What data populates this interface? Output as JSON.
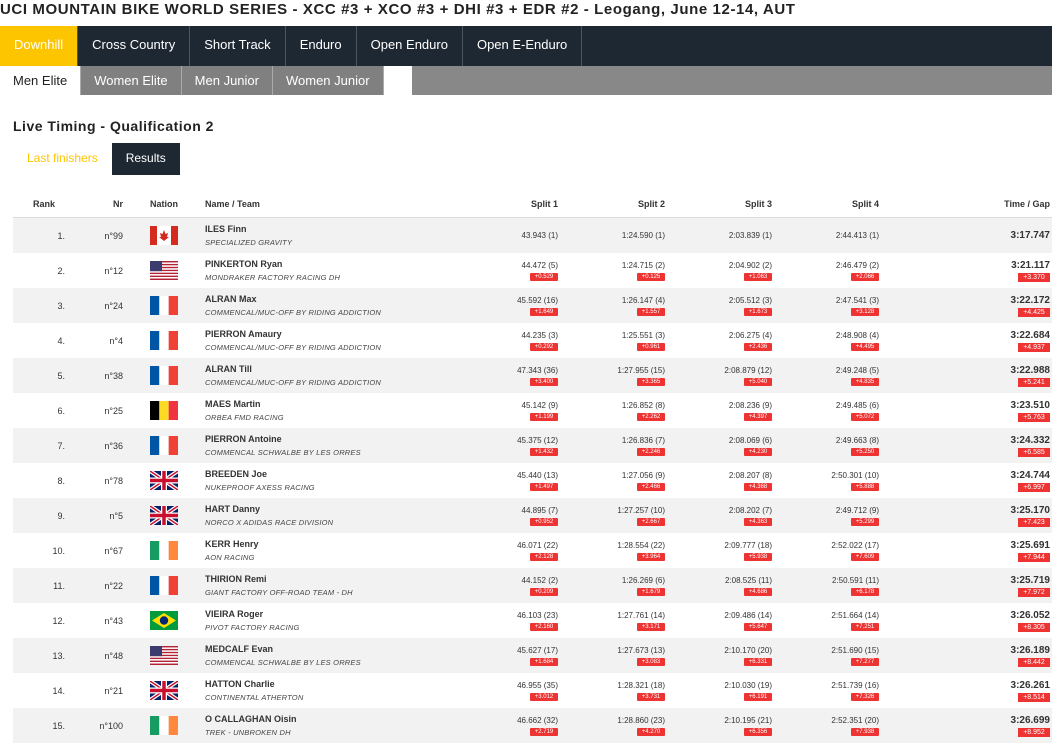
{
  "title": "UCI MOUNTAIN BIKE WORLD SERIES - XCC #3 + XCO #3 + DHI #3 + EDR #2 - Leogang, June 12-14, AUT",
  "disciplines": [
    {
      "label": "Downhill",
      "active": true
    },
    {
      "label": "Cross Country",
      "active": false
    },
    {
      "label": "Short Track",
      "active": false
    },
    {
      "label": "Enduro",
      "active": false
    },
    {
      "label": "Open Enduro",
      "active": false
    },
    {
      "label": "Open E-Enduro",
      "active": false
    }
  ],
  "categories": [
    {
      "label": "Men Elite",
      "active": true
    },
    {
      "label": "Women Elite",
      "active": false
    },
    {
      "label": "Men Junior",
      "active": false
    },
    {
      "label": "Women Junior",
      "active": false
    }
  ],
  "section_title": "Live Timing - Qualification 2",
  "subtabs": [
    {
      "label": "Last finishers",
      "active": false
    },
    {
      "label": "Results",
      "active": true
    }
  ],
  "columns": {
    "rank": "Rank",
    "nr": "Nr",
    "nation": "Nation",
    "name": "Name / Team",
    "split1": "Split 1",
    "split2": "Split 2",
    "split3": "Split 3",
    "split4": "Split 4",
    "time": "Time / Gap"
  },
  "colors": {
    "accent": "#fdc500",
    "nav": "#1e2833",
    "gap": "#e33333"
  },
  "rows": [
    {
      "rank": "1.",
      "nr": "n°99",
      "nation": "CAN",
      "name": "ILES Finn",
      "team": "SPECIALIZED GRAVITY",
      "s1": "43.943 (1)",
      "g1": "",
      "s2": "1:24.590 (1)",
      "g2": "",
      "s3": "2:03.839 (1)",
      "g3": "",
      "s4": "2:44.413 (1)",
      "g4": "",
      "time": "3:17.747",
      "gap": ""
    },
    {
      "rank": "2.",
      "nr": "n°12",
      "nation": "USA",
      "name": "PINKERTON Ryan",
      "team": "MONDRAKER FACTORY RACING DH",
      "s1": "44.472 (5)",
      "g1": "+0.529",
      "s2": "1:24.715 (2)",
      "g2": "+0.125",
      "s3": "2:04.902 (2)",
      "g3": "+1.063",
      "s4": "2:46.479 (2)",
      "g4": "+2.066",
      "time": "3:21.117",
      "gap": "+3.370"
    },
    {
      "rank": "3.",
      "nr": "n°24",
      "nation": "FRA",
      "name": "ALRAN Max",
      "team": "COMMENCAL/MUC-OFF BY RIDING ADDICTION",
      "s1": "45.592 (16)",
      "g1": "+1.649",
      "s2": "1:26.147 (4)",
      "g2": "+1.557",
      "s3": "2:05.512 (3)",
      "g3": "+1.673",
      "s4": "2:47.541 (3)",
      "g4": "+3.128",
      "time": "3:22.172",
      "gap": "+4.425"
    },
    {
      "rank": "4.",
      "nr": "n°4",
      "nation": "FRA",
      "name": "PIERRON Amaury",
      "team": "COMMENCAL/MUC-OFF BY RIDING ADDICTION",
      "s1": "44.235 (3)",
      "g1": "+0.292",
      "s2": "1:25.551 (3)",
      "g2": "+0.961",
      "s3": "2:06.275 (4)",
      "g3": "+2.436",
      "s4": "2:48.908 (4)",
      "g4": "+4.495",
      "time": "3:22.684",
      "gap": "+4.937"
    },
    {
      "rank": "5.",
      "nr": "n°38",
      "nation": "FRA",
      "name": "ALRAN Till",
      "team": "COMMENCAL/MUC-OFF BY RIDING ADDICTION",
      "s1": "47.343 (36)",
      "g1": "+3.400",
      "s2": "1:27.955 (15)",
      "g2": "+3.365",
      "s3": "2:08.879 (12)",
      "g3": "+5.040",
      "s4": "2:49.248 (5)",
      "g4": "+4.835",
      "time": "3:22.988",
      "gap": "+5.241"
    },
    {
      "rank": "6.",
      "nr": "n°25",
      "nation": "BEL",
      "name": "MAES Martin",
      "team": "ORBEA FMD RACING",
      "s1": "45.142 (9)",
      "g1": "+1.199",
      "s2": "1:26.852 (8)",
      "g2": "+2.262",
      "s3": "2:08.236 (9)",
      "g3": "+4.397",
      "s4": "2:49.485 (6)",
      "g4": "+5.072",
      "time": "3:23.510",
      "gap": "+5.763"
    },
    {
      "rank": "7.",
      "nr": "n°36",
      "nation": "FRA",
      "name": "PIERRON Antoine",
      "team": "COMMENCAL SCHWALBE BY LES ORRES",
      "s1": "45.375 (12)",
      "g1": "+1.432",
      "s2": "1:26.836 (7)",
      "g2": "+2.246",
      "s3": "2:08.069 (6)",
      "g3": "+4.230",
      "s4": "2:49.663 (8)",
      "g4": "+5.250",
      "time": "3:24.332",
      "gap": "+6.585"
    },
    {
      "rank": "8.",
      "nr": "n°78",
      "nation": "GBR",
      "name": "BREEDEN Joe",
      "team": "NUKEPROOF AXESS RACING",
      "s1": "45.440 (13)",
      "g1": "+1.497",
      "s2": "1:27.056 (9)",
      "g2": "+2.466",
      "s3": "2:08.207 (8)",
      "g3": "+4.368",
      "s4": "2:50.301 (10)",
      "g4": "+5.888",
      "time": "3:24.744",
      "gap": "+6.997"
    },
    {
      "rank": "9.",
      "nr": "n°5",
      "nation": "GBR",
      "name": "HART Danny",
      "team": "NORCO X ADIDAS RACE DIVISION",
      "s1": "44.895 (7)",
      "g1": "+0.952",
      "s2": "1:27.257 (10)",
      "g2": "+2.667",
      "s3": "2:08.202 (7)",
      "g3": "+4.363",
      "s4": "2:49.712 (9)",
      "g4": "+5.299",
      "time": "3:25.170",
      "gap": "+7.423"
    },
    {
      "rank": "10.",
      "nr": "n°67",
      "nation": "IRL",
      "name": "KERR Henry",
      "team": "AON RACING",
      "s1": "46.071 (22)",
      "g1": "+2.128",
      "s2": "1:28.554 (22)",
      "g2": "+3.964",
      "s3": "2:09.777 (18)",
      "g3": "+5.938",
      "s4": "2:52.022 (17)",
      "g4": "+7.609",
      "time": "3:25.691",
      "gap": "+7.944"
    },
    {
      "rank": "11.",
      "nr": "n°22",
      "nation": "FRA",
      "name": "THIRION Remi",
      "team": "GIANT FACTORY OFF-ROAD TEAM - DH",
      "s1": "44.152 (2)",
      "g1": "+0.209",
      "s2": "1:26.269 (6)",
      "g2": "+1.679",
      "s3": "2:08.525 (11)",
      "g3": "+4.686",
      "s4": "2:50.591 (11)",
      "g4": "+6.178",
      "time": "3:25.719",
      "gap": "+7.972"
    },
    {
      "rank": "12.",
      "nr": "n°43",
      "nation": "BRA",
      "name": "VIEIRA Roger",
      "team": "PIVOT FACTORY RACING",
      "s1": "46.103 (23)",
      "g1": "+2.160",
      "s2": "1:27.761 (14)",
      "g2": "+3.171",
      "s3": "2:09.486 (14)",
      "g3": "+5.647",
      "s4": "2:51.664 (14)",
      "g4": "+7.251",
      "time": "3:26.052",
      "gap": "+8.305"
    },
    {
      "rank": "13.",
      "nr": "n°48",
      "nation": "USA",
      "name": "MEDCALF Evan",
      "team": "COMMENCAL SCHWALBE BY LES ORRES",
      "s1": "45.627 (17)",
      "g1": "+1.684",
      "s2": "1:27.673 (13)",
      "g2": "+3.083",
      "s3": "2:10.170 (20)",
      "g3": "+6.331",
      "s4": "2:51.690 (15)",
      "g4": "+7.277",
      "time": "3:26.189",
      "gap": "+8.442"
    },
    {
      "rank": "14.",
      "nr": "n°21",
      "nation": "GBR",
      "name": "HATTON Charlie",
      "team": "CONTINENTAL ATHERTON",
      "s1": "46.955 (35)",
      "g1": "+3.012",
      "s2": "1:28.321 (18)",
      "g2": "+3.731",
      "s3": "2:10.030 (19)",
      "g3": "+6.191",
      "s4": "2:51.739 (16)",
      "g4": "+7.326",
      "time": "3:26.261",
      "gap": "+8.514"
    },
    {
      "rank": "15.",
      "nr": "n°100",
      "nation": "IRL",
      "name": "O CALLAGHAN Oisin",
      "team": "TREK - UNBROKEN DH",
      "s1": "46.662 (32)",
      "g1": "+2.719",
      "s2": "1:28.860 (23)",
      "g2": "+4.270",
      "s3": "2:10.195 (21)",
      "g3": "+6.356",
      "s4": "2:52.351 (20)",
      "g4": "+7.938",
      "time": "3:26.699",
      "gap": "+8.952"
    }
  ]
}
